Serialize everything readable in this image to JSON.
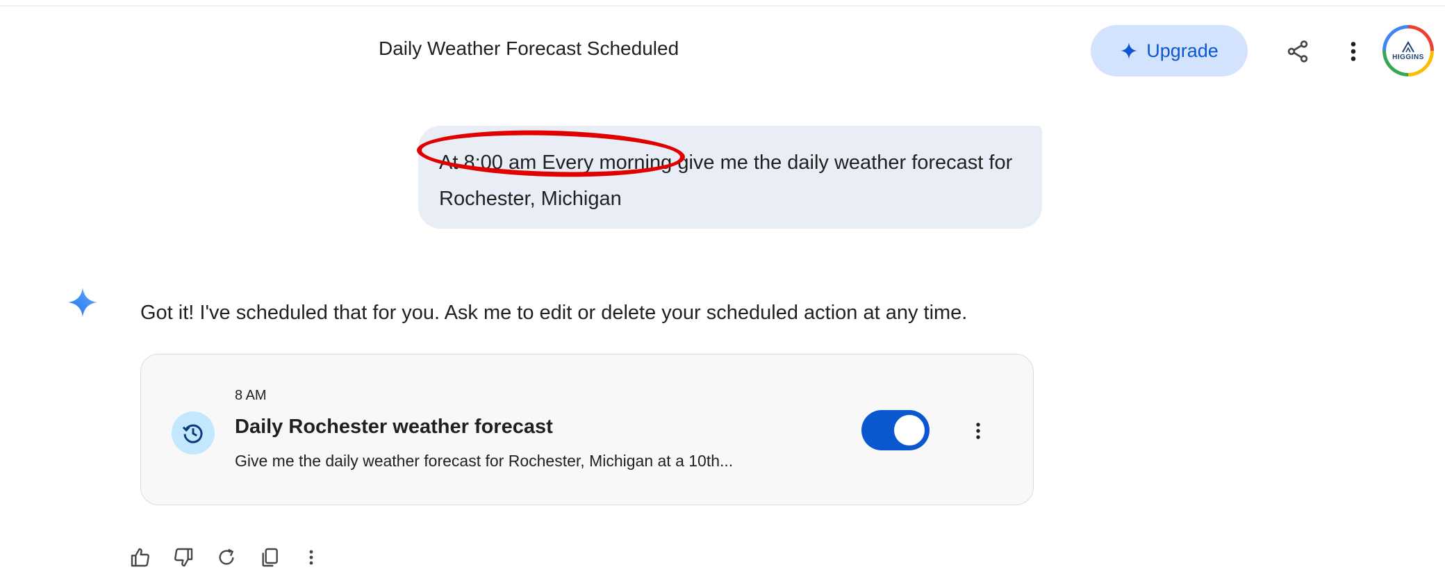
{
  "header": {
    "conversation_title": "Daily Weather Forecast Scheduled",
    "upgrade_label": "Upgrade",
    "avatar_text": "HIGGINS"
  },
  "user_message": {
    "text": "At 8:00 am Every morning give me the daily weather forecast for Rochester, Michigan",
    "annotation": "red-oval-highlight"
  },
  "response": {
    "text": "Got it! I've scheduled that for you. Ask me to edit or delete your scheduled action at any time."
  },
  "scheduled_action": {
    "time": "8 AM",
    "title": "Daily Rochester weather forecast",
    "description": "Give me the daily weather forecast for Rochester, Michigan at a 10th...",
    "enabled": true
  },
  "icons": {
    "upgrade": "sparkle-icon",
    "share": "share-icon",
    "more": "more-vert-icon",
    "assistant": "gemini-spark-icon",
    "schedule": "schedule-history-icon",
    "feedback": [
      "thumb-up-icon",
      "thumb-down-icon",
      "redo-icon",
      "copy-icon",
      "more-vert-icon"
    ]
  },
  "colors": {
    "accent": "#0b57d0",
    "upgrade_bg": "#d3e3fd",
    "user_bubble_bg": "#e9eef6",
    "annotation_red": "#e00000",
    "schedule_icon_bg": "#c2e7ff"
  }
}
